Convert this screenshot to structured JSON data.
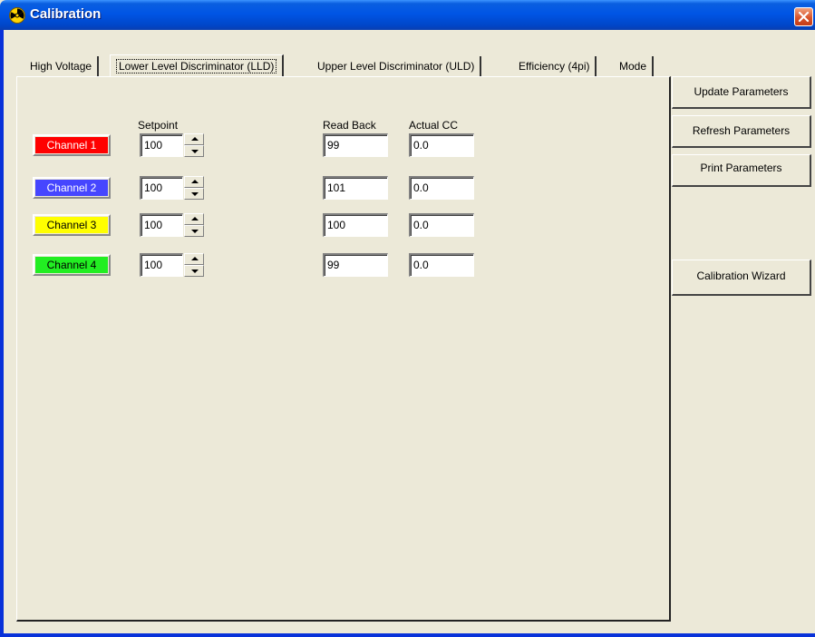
{
  "window": {
    "title": "Calibration"
  },
  "colors": {
    "titlebar": "#0055e5",
    "close": "#d8542c"
  },
  "tabs": [
    {
      "label": "High Voltage",
      "active": false
    },
    {
      "label": "Lower Level Discriminator (LLD)",
      "active": true
    },
    {
      "label": "Upper Level Discriminator (ULD)",
      "active": false
    },
    {
      "label": "Efficiency (4pi)",
      "active": false
    },
    {
      "label": "Mode",
      "active": false
    }
  ],
  "columns": {
    "setpoint": "Setpoint",
    "readback": "Read Back",
    "actual_cc": "Actual CC"
  },
  "channels": [
    {
      "label": "Channel 1",
      "color": "#ff0000",
      "text_color": "#ffffff",
      "setpoint": "100",
      "readback": "99",
      "actual_cc": "0.0"
    },
    {
      "label": "Channel 2",
      "color": "#4646ff",
      "text_color": "#ffffff",
      "setpoint": "100",
      "readback": "101",
      "actual_cc": "0.0"
    },
    {
      "label": "Channel 3",
      "color": "#ffff00",
      "text_color": "#000000",
      "setpoint": "100",
      "readback": "100",
      "actual_cc": "0.0"
    },
    {
      "label": "Channel 4",
      "color": "#22ee22",
      "text_color": "#000000",
      "setpoint": "100",
      "readback": "99",
      "actual_cc": "0.0"
    }
  ],
  "buttons": {
    "update": "Update Parameters",
    "refresh": "Refresh Parameters",
    "print": "Print Parameters",
    "wizard": "Calibration Wizard"
  }
}
